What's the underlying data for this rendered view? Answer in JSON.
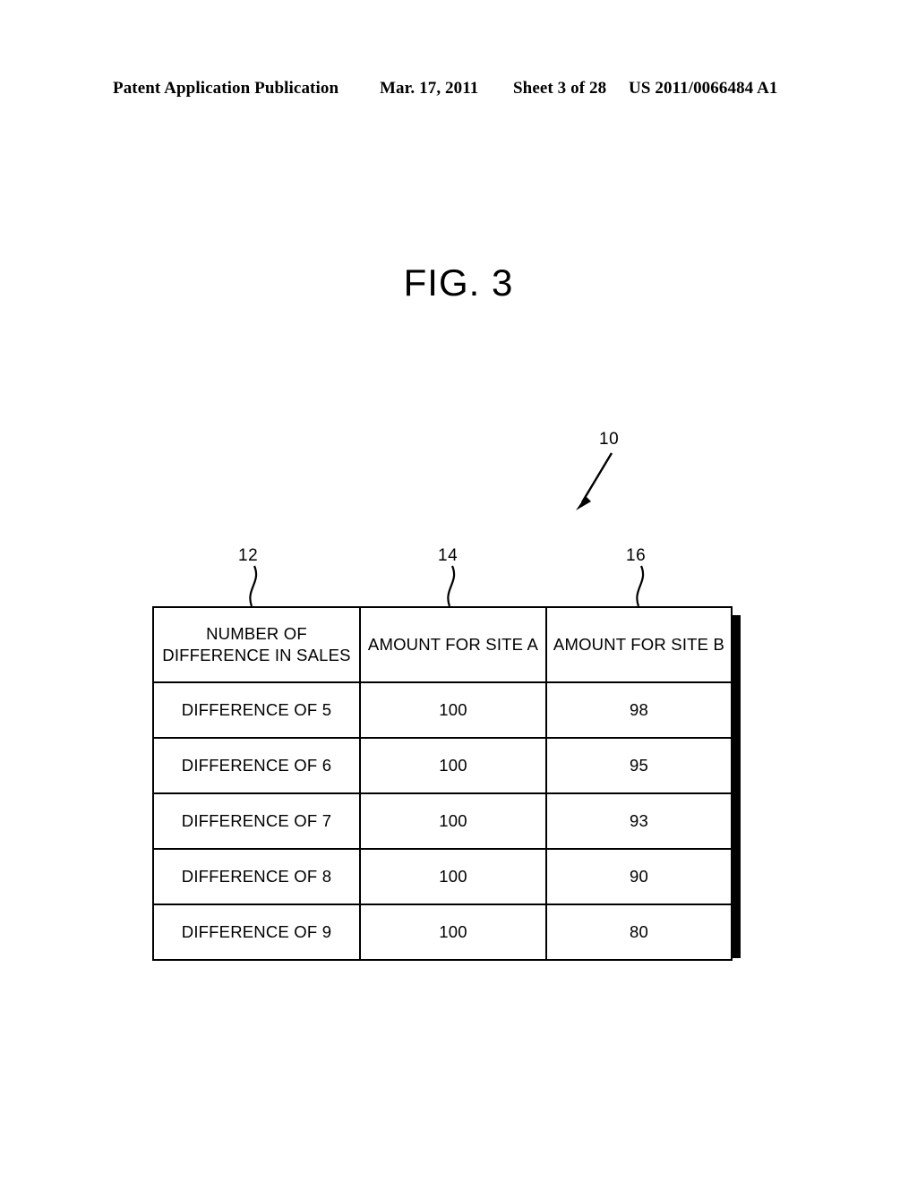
{
  "page_header": {
    "publication": "Patent Application Publication",
    "date": "Mar. 17, 2011",
    "sheet": "Sheet 3 of 28",
    "patent_number": "US 2011/0066484 A1"
  },
  "figure": {
    "title": "FIG. 3",
    "reference_numerals": {
      "assembly": "10",
      "column_1": "12",
      "column_2": "14",
      "column_3": "16"
    }
  },
  "table": {
    "headers": {
      "col1_line1": "NUMBER OF",
      "col1_line2": "DIFFERENCE IN SALES",
      "col2": "AMOUNT FOR SITE A",
      "col3": "AMOUNT FOR SITE B"
    },
    "rows": [
      {
        "label": "DIFFERENCE OF 5",
        "site_a": "100",
        "site_b": "98"
      },
      {
        "label": "DIFFERENCE OF 6",
        "site_a": "100",
        "site_b": "95"
      },
      {
        "label": "DIFFERENCE OF 7",
        "site_a": "100",
        "site_b": "93"
      },
      {
        "label": "DIFFERENCE OF 8",
        "site_a": "100",
        "site_b": "90"
      },
      {
        "label": "DIFFERENCE OF 9",
        "site_a": "100",
        "site_b": "80"
      }
    ]
  },
  "colors": {
    "ink": "#000000",
    "paper": "#ffffff"
  }
}
